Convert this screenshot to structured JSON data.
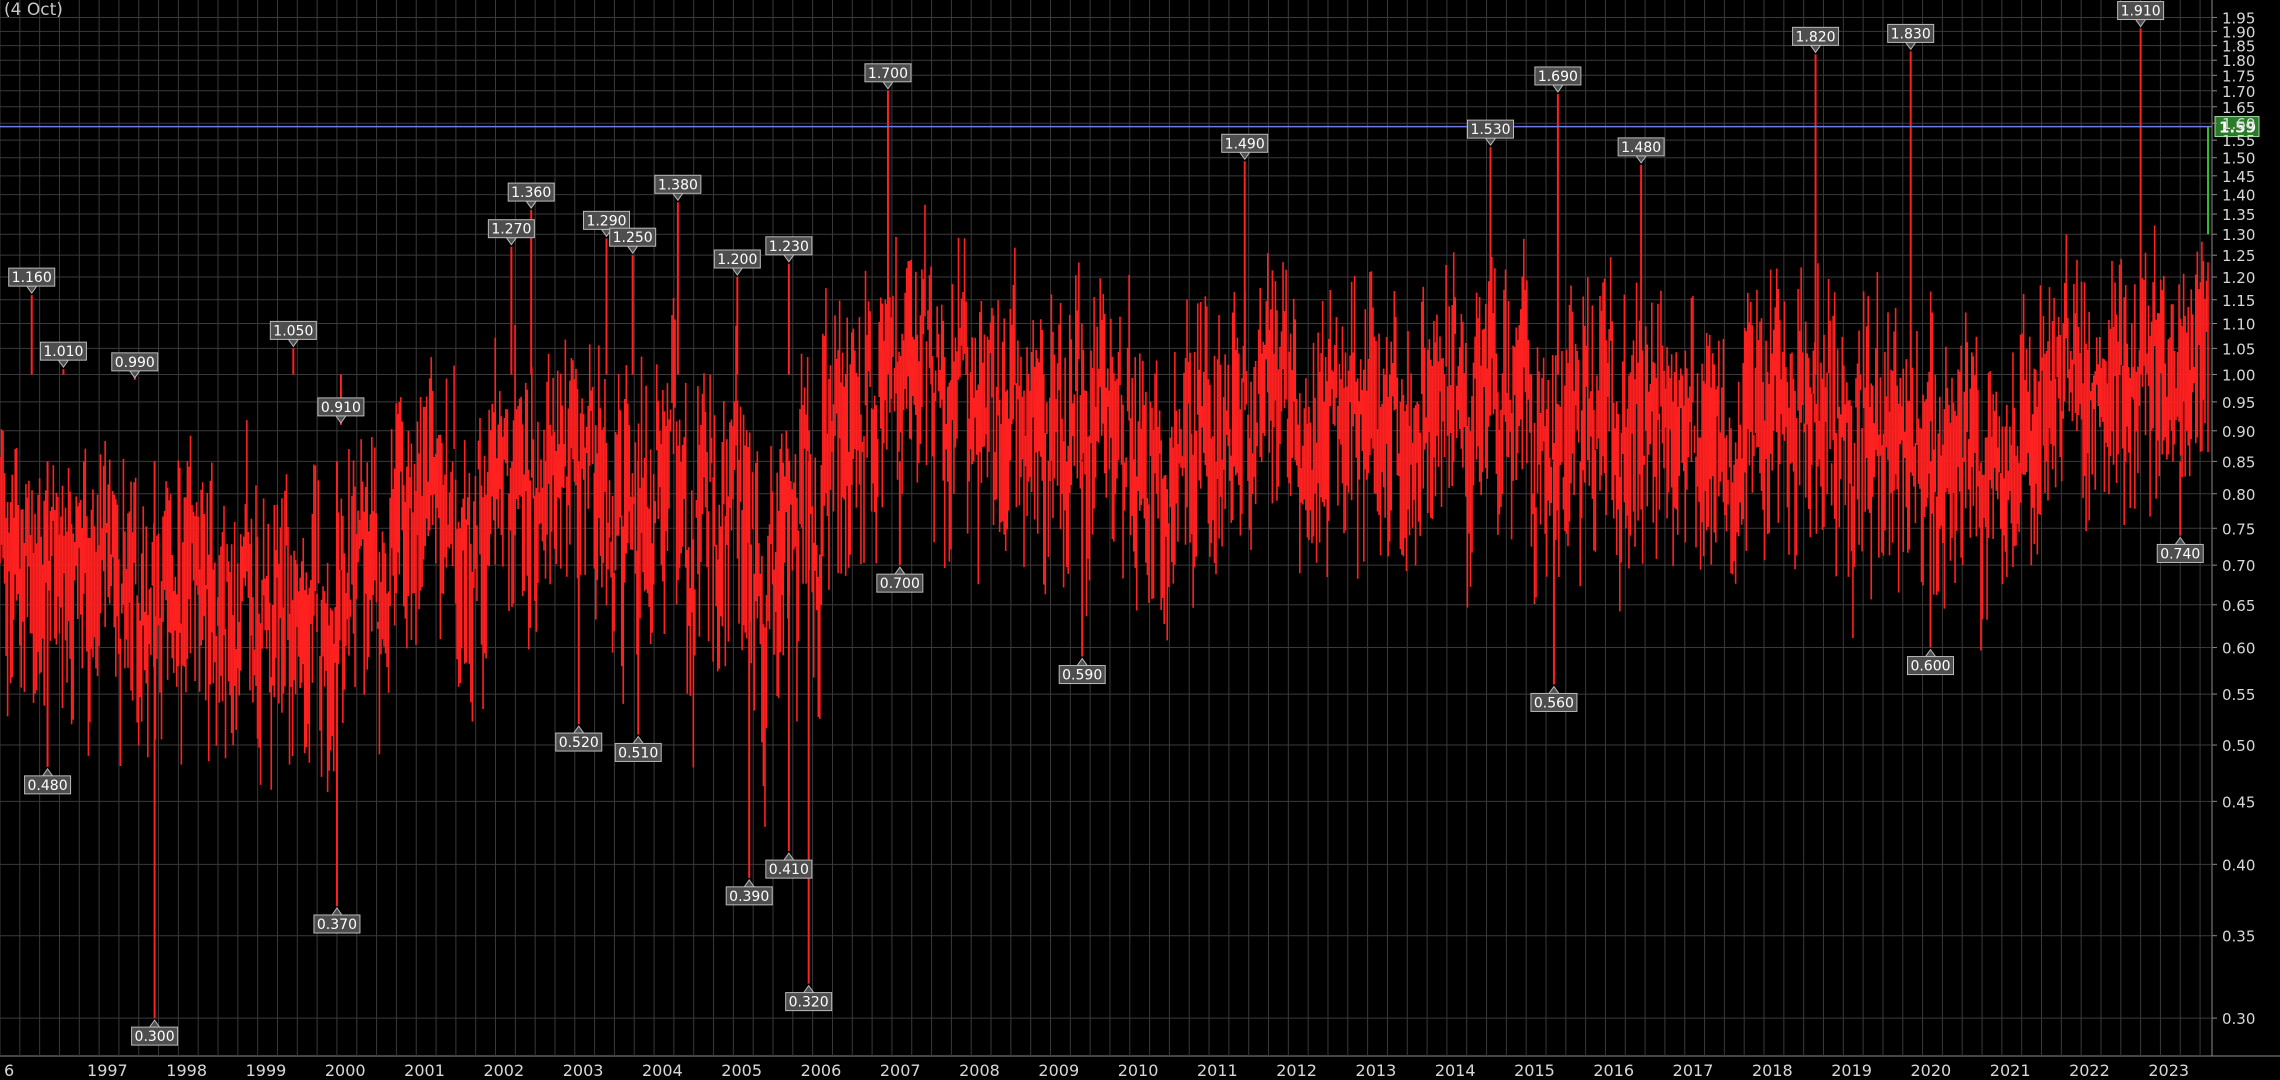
{
  "header": {
    "corner_label": "(4 Oct)"
  },
  "colors": {
    "background": "#000000",
    "grid": "#3a3a3a",
    "bars": "#ff2020",
    "bar_centre": "#5d7a1e",
    "reference_line": "#6a7ae6",
    "last_value_box": "#2a7a2a",
    "axis_text": "#d8d8d8",
    "label_box": "#4e4e4e"
  },
  "chart_data": {
    "type": "bar",
    "style": "dense high-low bars (one bar per period)",
    "title": "",
    "xlabel": "",
    "ylabel": "",
    "y_scale": "log",
    "ylim": [
      0.28,
      1.97
    ],
    "grid": true,
    "y_ticks": [
      "0.30",
      "0.35",
      "0.40",
      "0.45",
      "0.50",
      "0.55",
      "0.60",
      "0.65",
      "0.70",
      "0.75",
      "0.80",
      "0.85",
      "0.90",
      "0.95",
      "1.00",
      "1.05",
      "1.10",
      "1.15",
      "1.20",
      "1.25",
      "1.30",
      "1.35",
      "1.40",
      "1.45",
      "1.50",
      "1.55",
      "1.60",
      "1.65",
      "1.70",
      "1.75",
      "1.80",
      "1.85",
      "1.90",
      "1.95"
    ],
    "x_ticks": [
      "6",
      "1997",
      "1998",
      "1999",
      "2000",
      "2001",
      "2002",
      "2003",
      "2004",
      "2005",
      "2006",
      "2007",
      "2008",
      "2009",
      "2010",
      "2011",
      "2012",
      "2013",
      "2014",
      "2015",
      "2016",
      "2017",
      "2018",
      "2019",
      "2020",
      "2021",
      "2022",
      "2023"
    ],
    "x_range_years": [
      1996.0,
      2023.85
    ],
    "reference_line": {
      "value": 1.59
    },
    "last_value": "1.59",
    "high_labels": [
      {
        "date": "1996.4",
        "value": 1.16,
        "text": "1.160"
      },
      {
        "date": "1996.8",
        "value": 1.01,
        "text": "1.010"
      },
      {
        "date": "1997.7",
        "value": 0.99,
        "text": "0.990"
      },
      {
        "date": "1999.7",
        "value": 1.05,
        "text": "1.050"
      },
      {
        "date": "2000.3",
        "value": 0.91,
        "text": "0.910"
      },
      {
        "date": "2002.45",
        "value": 1.27,
        "text": "1.270"
      },
      {
        "date": "2002.7",
        "value": 1.36,
        "text": "1.360"
      },
      {
        "date": "2003.65",
        "value": 1.29,
        "text": "1.290"
      },
      {
        "date": "2003.98",
        "value": 1.25,
        "text": "1.250"
      },
      {
        "date": "2004.55",
        "value": 1.38,
        "text": "1.380"
      },
      {
        "date": "2005.3",
        "value": 1.2,
        "text": "1.200"
      },
      {
        "date": "2005.95",
        "value": 1.23,
        "text": "1.230"
      },
      {
        "date": "2007.2",
        "value": 1.7,
        "text": "1.700"
      },
      {
        "date": "2011.7",
        "value": 1.49,
        "text": "1.490"
      },
      {
        "date": "2014.8",
        "value": 1.53,
        "text": "1.530"
      },
      {
        "date": "2015.65",
        "value": 1.69,
        "text": "1.690"
      },
      {
        "date": "2016.7",
        "value": 1.48,
        "text": "1.480"
      },
      {
        "date": "2018.9",
        "value": 1.82,
        "text": "1.820"
      },
      {
        "date": "2020.1",
        "value": 1.83,
        "text": "1.830"
      },
      {
        "date": "2023.0",
        "value": 1.91,
        "text": "1.910"
      }
    ],
    "low_labels": [
      {
        "date": "1996.6",
        "value": 0.48,
        "text": "0.480"
      },
      {
        "date": "1997.95",
        "value": 0.3,
        "text": "0.300"
      },
      {
        "date": "2000.25",
        "value": 0.37,
        "text": "0.370"
      },
      {
        "date": "2003.3",
        "value": 0.52,
        "text": "0.520"
      },
      {
        "date": "2004.05",
        "value": 0.51,
        "text": "0.510"
      },
      {
        "date": "2005.45",
        "value": 0.39,
        "text": "0.390"
      },
      {
        "date": "2005.95",
        "value": 0.41,
        "text": "0.410"
      },
      {
        "date": "2006.2",
        "value": 0.32,
        "text": "0.320"
      },
      {
        "date": "2007.35",
        "value": 0.7,
        "text": "0.700"
      },
      {
        "date": "2009.65",
        "value": 0.59,
        "text": "0.590"
      },
      {
        "date": "2015.6",
        "value": 0.56,
        "text": "0.560"
      },
      {
        "date": "2020.35",
        "value": 0.6,
        "text": "0.600"
      },
      {
        "date": "2023.5",
        "value": 0.74,
        "text": "0.740"
      }
    ],
    "series": [
      {
        "values_approx_by_year": [
          {
            "x": "1996.0",
            "low": 0.5,
            "high": 1.0
          },
          {
            "x": "1997.0",
            "low": 0.48,
            "high": 1.0
          },
          {
            "x": "1998.0",
            "low": 0.45,
            "high": 0.95
          },
          {
            "x": "1999.0",
            "low": 0.42,
            "high": 1.0
          },
          {
            "x": "2000.0",
            "low": 0.38,
            "high": 1.0
          },
          {
            "x": "2001.0",
            "low": 0.48,
            "high": 1.1
          },
          {
            "x": "2002.0",
            "low": 0.5,
            "high": 1.25
          },
          {
            "x": "2003.0",
            "low": 0.52,
            "high": 1.3
          },
          {
            "x": "2004.0",
            "low": 0.5,
            "high": 1.3
          },
          {
            "x": "2005.0",
            "low": 0.4,
            "high": 1.25
          },
          {
            "x": "2006.0",
            "low": 0.4,
            "high": 1.3
          },
          {
            "x": "2007.0",
            "low": 0.68,
            "high": 1.45
          },
          {
            "x": "2008.0",
            "low": 0.65,
            "high": 1.45
          },
          {
            "x": "2009.0",
            "low": 0.62,
            "high": 1.35
          },
          {
            "x": "2010.0",
            "low": 0.6,
            "high": 1.3
          },
          {
            "x": "2011.0",
            "low": 0.6,
            "high": 1.4
          },
          {
            "x": "2012.0",
            "low": 0.65,
            "high": 1.35
          },
          {
            "x": "2013.0",
            "low": 0.65,
            "high": 1.3
          },
          {
            "x": "2014.0",
            "low": 0.62,
            "high": 1.35
          },
          {
            "x": "2015.0",
            "low": 0.6,
            "high": 1.4
          },
          {
            "x": "2016.0",
            "low": 0.62,
            "high": 1.4
          },
          {
            "x": "2017.0",
            "low": 0.65,
            "high": 1.35
          },
          {
            "x": "2018.0",
            "low": 0.65,
            "high": 1.35
          },
          {
            "x": "2019.0",
            "low": 0.65,
            "high": 1.35
          },
          {
            "x": "2020.0",
            "low": 0.62,
            "high": 1.3
          },
          {
            "x": "2021.0",
            "low": 0.6,
            "high": 1.15
          },
          {
            "x": "2022.0",
            "low": 0.75,
            "high": 1.3
          },
          {
            "x": "2023.0",
            "low": 0.75,
            "high": 1.3
          },
          {
            "x": "2023.8",
            "low": 0.9,
            "high": 1.3
          }
        ]
      }
    ]
  }
}
